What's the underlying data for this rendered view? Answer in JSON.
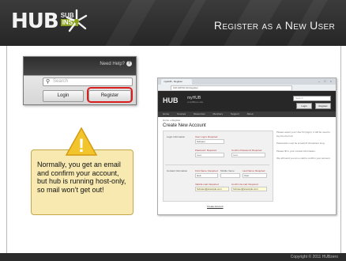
{
  "header": {
    "logo_main": "HUB",
    "logo_sub_top": "SUB",
    "logo_sub_bottom": "INST",
    "title": "Register as a New User"
  },
  "login_widget": {
    "need_help": "Need Help?",
    "help_icon": "?",
    "search_icon": "magnifier",
    "search_placeholder": "Search",
    "login_label": "Login",
    "register_label": "Register",
    "highlight_color": "#d91e1e"
  },
  "callout": {
    "warning_icon": "!",
    "text": "Normally, you get an email and confirm your account, but hub is running host-only, so mail won’t get out!"
  },
  "screenshot": {
    "tab_label": "myHUB - Register",
    "url": "192.168.56.101/register",
    "site_logo": "HUB",
    "site_name": "myHUB",
    "site_tagline": "a HUBzero site",
    "search_placeholder": "Search",
    "login_label": "Login",
    "register_label": "Register",
    "nav": [
      "Home",
      "Courses",
      "Resources",
      "Members",
      "Support",
      "About"
    ],
    "crumb": "Home » Register",
    "page_title": "Create New Account",
    "login_info_legend": "Login Information",
    "contact_info_legend": "Contact Information",
    "fields": [
      {
        "label": "User Login: Required",
        "value": "hubuser"
      },
      {
        "label": "Password: Required",
        "value": "••••••"
      },
      {
        "label": "Confirm Password: Required",
        "value": "••••••"
      },
      {
        "label": "First Name: Required",
        "value": "Hub"
      },
      {
        "label": "Middle Name",
        "value": ""
      },
      {
        "label": "Last Name: Required",
        "value": "User"
      },
      {
        "label": "Valid E-mail: Required",
        "value": "hubuser@example.com"
      },
      {
        "label": "Confirm E-mail: Required",
        "value": "hubuser@example.com"
      }
    ],
    "create_button": "Create Account",
    "side_notes": [
      "Please select your User ID (login). It will be used to log into the hub.",
      "Passwords must be at least 8 characters long.",
      "Please fill in your contact information.",
      "We will send you an e-mail to confirm your account."
    ]
  },
  "footer": {
    "copyright": "Copyright © 2011 HUBzero"
  }
}
